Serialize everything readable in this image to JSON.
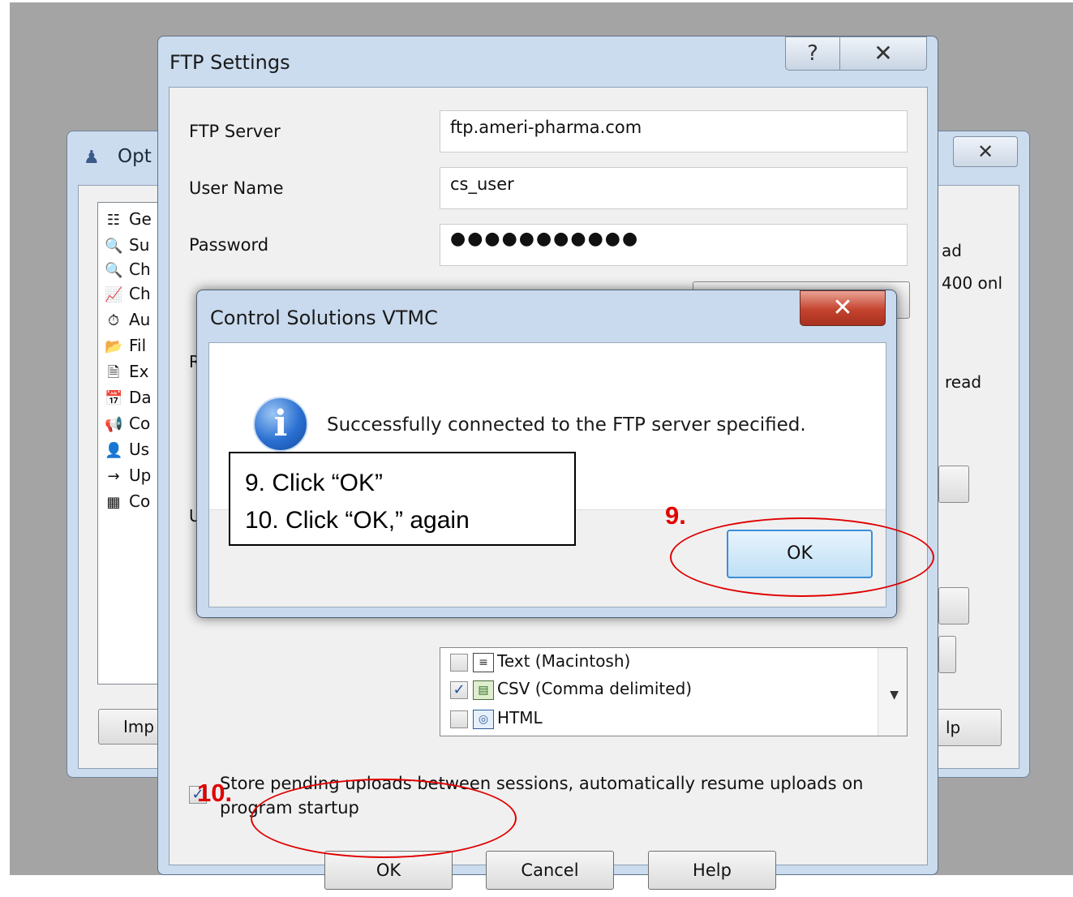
{
  "options_window": {
    "title": "Opt",
    "close_glyph": "✕",
    "list_items": [
      {
        "label": "Ge",
        "icon": "settings-list-icon",
        "glyph": "☷"
      },
      {
        "label": "Su",
        "icon": "magnifier-fx-icon",
        "glyph": "🔍"
      },
      {
        "label": "Ch",
        "icon": "magnifier-fx-icon",
        "glyph": "🔍"
      },
      {
        "label": "Ch",
        "icon": "chart-line-icon",
        "glyph": "📈"
      },
      {
        "label": "Au",
        "icon": "stopwatch-icon",
        "glyph": "⏱"
      },
      {
        "label": "Fil",
        "icon": "folder-icon",
        "glyph": "📂"
      },
      {
        "label": "Ex",
        "icon": "text-document-icon",
        "glyph": "🗎"
      },
      {
        "label": "Da",
        "icon": "calendar-clock-icon",
        "glyph": "📅"
      },
      {
        "label": "Co",
        "icon": "speaker-icon",
        "glyph": "📢"
      },
      {
        "label": "Us",
        "icon": "user-icon",
        "glyph": "👤"
      },
      {
        "label": "Up",
        "icon": "arrow-right-icon",
        "glyph": "→"
      },
      {
        "label": "Co",
        "icon": "grid-icon",
        "glyph": "▦"
      }
    ],
    "import_button": "Imp",
    "right_fragments": {
      "line1": "ad",
      "line2": "400 onl",
      "line3": "read",
      "help": "lp"
    }
  },
  "ftp_settings": {
    "title": "FTP Settings",
    "help_glyph": "?",
    "close_glyph": "✕",
    "server_label": "FTP Server",
    "server_value": "ftp.ameri-pharma.com",
    "username_label": "User Name",
    "username_value": "cs_user",
    "password_label": "Password",
    "password_value": "●●●●●●●●●●●",
    "hidden_label_r": "R",
    "hidden_label_u": "U",
    "formats": [
      {
        "label": "Text (Macintosh)",
        "checked": false
      },
      {
        "label": "CSV (Comma delimited)",
        "checked": true
      },
      {
        "label": "HTML",
        "checked": false
      }
    ],
    "check_glyph": "✓",
    "scroll_down_glyph": "▼",
    "store_pending_label": "Store pending uploads between sessions, automatically resume uploads on program startup",
    "store_pending_checked": true,
    "ok_button": "OK",
    "cancel_button": "Cancel",
    "help_button": "Help"
  },
  "message_box": {
    "title": "Control Solutions VTMC",
    "close_glyph": "✕",
    "info_glyph": "i",
    "message": "Successfully connected to the FTP server specified.",
    "ok_button": "OK"
  },
  "annotations": {
    "callout_line1": "9. Click “OK”",
    "callout_line2": "10. Click “OK,” again",
    "step9": "9.",
    "step10": "10.",
    "highlight_color": "#e00000"
  }
}
